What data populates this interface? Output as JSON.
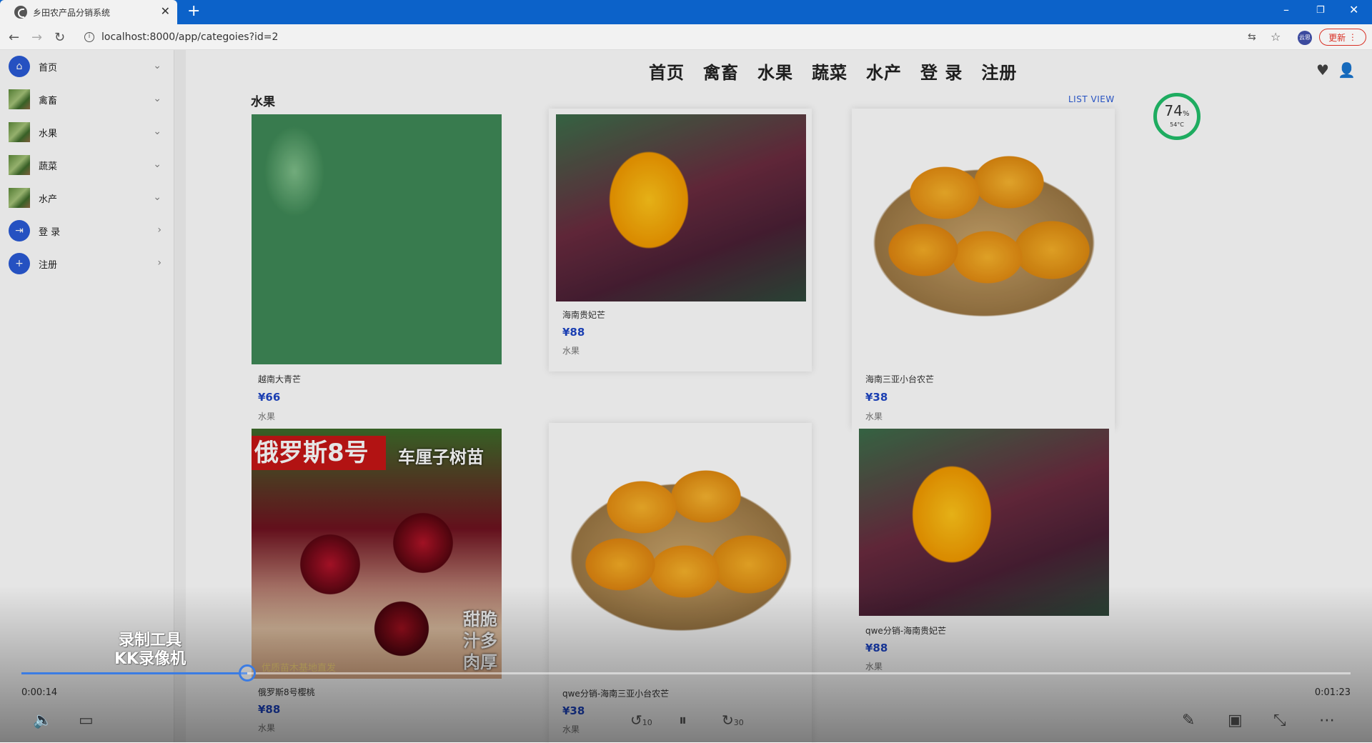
{
  "browser": {
    "tab_title": "乡田农产品分销系统",
    "url": "localhost:8000/app/categoies?id=2",
    "update_label": "更新",
    "profile_label": "云思"
  },
  "sidebar": {
    "items": [
      {
        "label": "首页",
        "icon": "home-icon"
      },
      {
        "label": "禽畜",
        "icon": "thumbnail"
      },
      {
        "label": "水果",
        "icon": "thumbnail"
      },
      {
        "label": "蔬菜",
        "icon": "thumbnail"
      },
      {
        "label": "水产",
        "icon": "thumbnail"
      },
      {
        "label": "登 录",
        "icon": "login-icon"
      },
      {
        "label": "注册",
        "icon": "add-user-icon"
      }
    ]
  },
  "topnav": [
    "首页",
    "禽畜",
    "水果",
    "蔬菜",
    "水产",
    "登 录",
    "注册"
  ],
  "section": {
    "title": "水果",
    "list_view": "LIST VIEW"
  },
  "products": [
    {
      "name": "越南大青芒",
      "price": "¥66",
      "category": "水果"
    },
    {
      "name": "海南贵妃芒",
      "price": "¥88",
      "category": "水果"
    },
    {
      "name": "海南三亚小台农芒",
      "price": "¥38",
      "category": "水果"
    },
    {
      "name": "俄罗斯8号樱桃",
      "price": "¥88",
      "category": "水果",
      "banner": "俄罗斯8号",
      "banner_sub": "车厘子树苗",
      "side_text": "甜脆汁多肉厚",
      "foot_text": "优质苗木基地直发"
    },
    {
      "name": "qwe分销-海南三亚小台农芒",
      "price": "¥38",
      "category": "水果"
    },
    {
      "name": "qwe分销-海南贵妃芒",
      "price": "¥88",
      "category": "水果"
    }
  ],
  "widget": {
    "percent": "74",
    "percent_unit": "%",
    "temp": "54°C"
  },
  "player": {
    "current_time": "0:00:14",
    "total_time": "0:01:23",
    "progress": 0.17,
    "rewind_label": "10",
    "forward_label": "30",
    "watermark_line1": "录制工具",
    "watermark_line2": "KK录像机"
  },
  "colors": {
    "accent": "#1f47c7",
    "tabbar": "#0c62c9",
    "gauge": "#22c06b"
  }
}
